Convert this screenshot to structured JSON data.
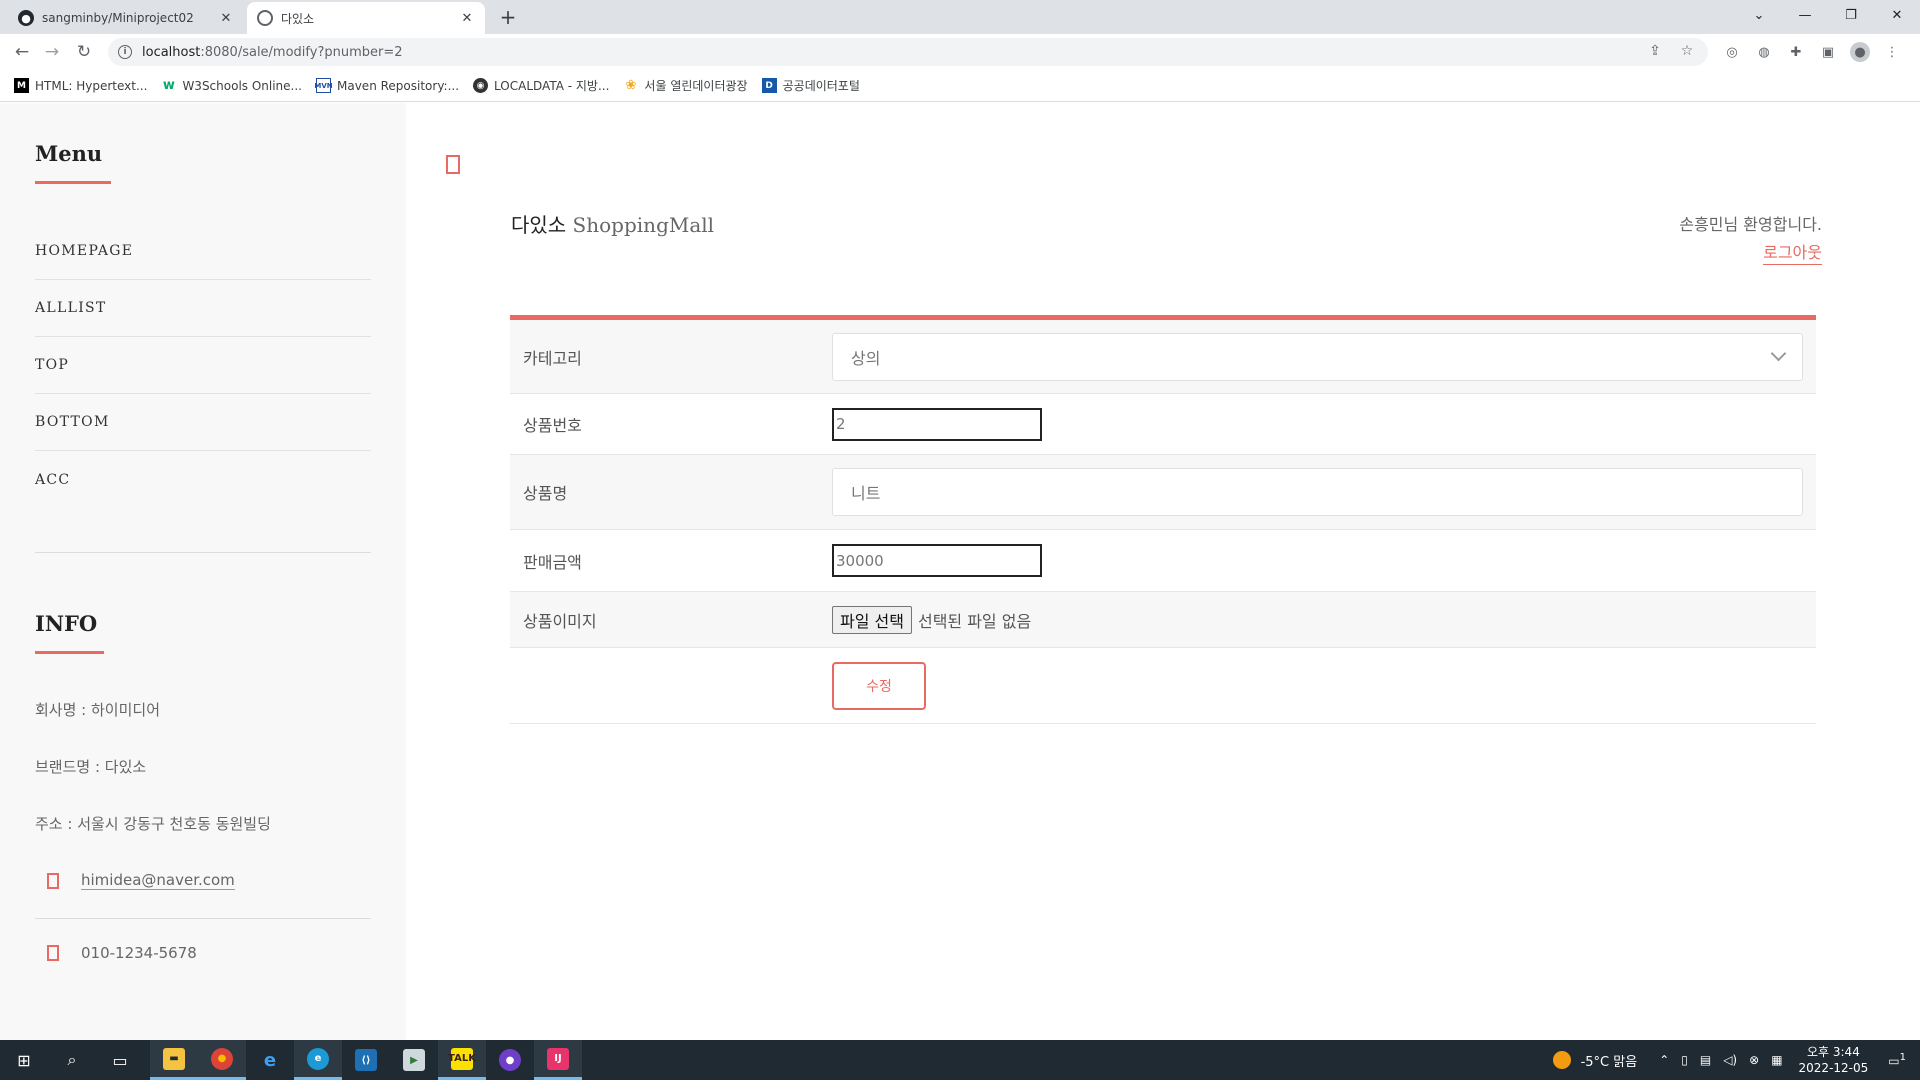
{
  "browser": {
    "tabs": [
      {
        "title": "sangminby/Miniproject02",
        "icon": "github-icon"
      },
      {
        "title": "다있소",
        "icon": "globe-icon"
      }
    ],
    "new_tab_label": "+",
    "url_host": "localhost",
    "url_path": ":8080/sale/modify?pnumber=2",
    "bookmarks": [
      {
        "label": "HTML: Hypertext...",
        "icon_text": "M"
      },
      {
        "label": "W3Schools Online...",
        "icon_text": "w"
      },
      {
        "label": "Maven Repository:...",
        "icon_text": "MVN"
      },
      {
        "label": "LOCALDATA - 지방...",
        "icon_text": "◉"
      },
      {
        "label": "서울 열린데이터광장",
        "icon_text": "❀"
      },
      {
        "label": "공공데이터포털",
        "icon_text": "D"
      }
    ]
  },
  "sidebar": {
    "menu_title": "Menu",
    "menu_items": [
      "HOMEPAGE",
      "ALLLIST",
      "TOP",
      "BOTTOM",
      "ACC"
    ],
    "info_title": "INFO",
    "company": "회사명 : 하이미디어",
    "brand": "브랜드명 : 다있소",
    "address": "주소 : 서울시 강동구 천호동 동원빌딩",
    "email": "himidea@naver.com",
    "phone": "010-1234-5678"
  },
  "header": {
    "brand_main": "다있소",
    "brand_sub": " ShoppingMall",
    "welcome": "손흥민님 환영합니다.",
    "logout": "로그아웃"
  },
  "form": {
    "category_label": "카테고리",
    "category_value": "상의",
    "number_label": "상품번호",
    "number_value": "2",
    "name_label": "상품명",
    "name_value": "니트",
    "price_label": "판매금액",
    "price_value": "30000",
    "image_label": "상품이미지",
    "file_button": "파일 선택",
    "file_status": "선택된 파일 없음",
    "submit": "수정"
  },
  "taskbar": {
    "weather": "-5°C  맑음",
    "time": "오후 3:44",
    "date": "2022-12-05",
    "notifications": "1"
  },
  "colors": {
    "accent": "#e96a62",
    "taskbar": "#1f2a33"
  }
}
